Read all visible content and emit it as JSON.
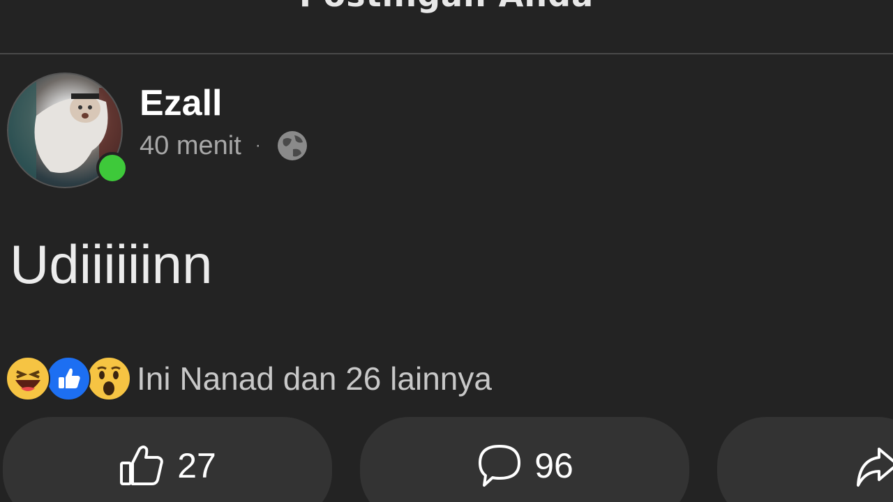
{
  "header": {
    "title": "Postingan Anda"
  },
  "post": {
    "author": "Ezall",
    "time": "40 menit",
    "separator": "·",
    "privacy_icon": "globe-icon",
    "online_status_color": "#3ec93a",
    "text": "Udiiiiiinn",
    "reactions": {
      "icons": [
        "haha-icon",
        "like-icon",
        "wow-icon"
      ],
      "summary": "Ini Nanad dan 26 lainnya"
    },
    "actions": {
      "like_count": "27",
      "comment_count": "96"
    }
  },
  "colors": {
    "background": "#232323",
    "button_bg": "#333333",
    "like_blue": "#1d6ff2",
    "emoji_yellow": "#f6c443"
  }
}
